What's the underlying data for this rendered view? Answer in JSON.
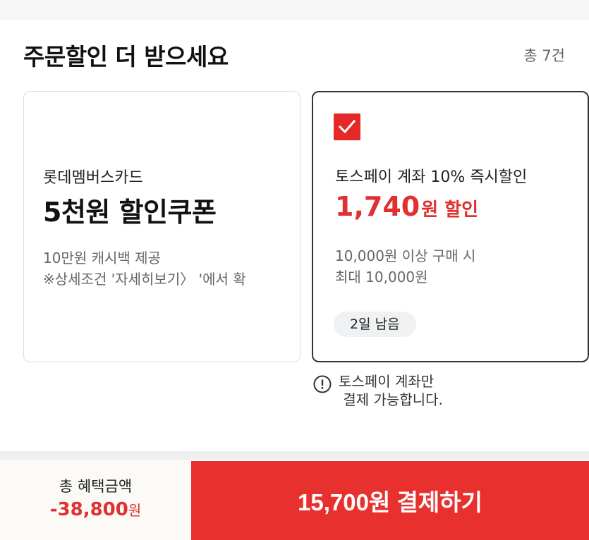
{
  "header": {
    "title": "주문할인 더 받으세요",
    "total_count": "총 7건"
  },
  "offers": [
    {
      "brand": "롯데멤버스카드",
      "headline": "5천원 할인쿠폰",
      "desc_lines": [
        "10만원 캐시백 제공",
        "※상세조건 '자세히보기〉 '에서 확"
      ],
      "selected": false
    },
    {
      "brand": "토스페이 계좌 10% 즉시할인",
      "discount_amount": "1,740",
      "discount_suffix": "원 할인",
      "desc_lines": [
        "10,000원 이상 구매 시",
        "최대 10,000원"
      ],
      "days_left": "2일 남음",
      "selected": true
    }
  ],
  "notice": {
    "line1": "토스페이 계좌만",
    "line2": " 결제 가능합니다."
  },
  "footer": {
    "benefit_label": "총 혜택금액",
    "benefit_amount": "-38,800",
    "benefit_unit": "원",
    "pay_label": "15,700원 결제하기"
  },
  "colors": {
    "accent_red": "#e8312f",
    "discount_red": "#e03030",
    "badge_bg": "#eff1f3"
  },
  "icons": {
    "checkbox": "check-icon",
    "notice": "info-circle-icon"
  }
}
